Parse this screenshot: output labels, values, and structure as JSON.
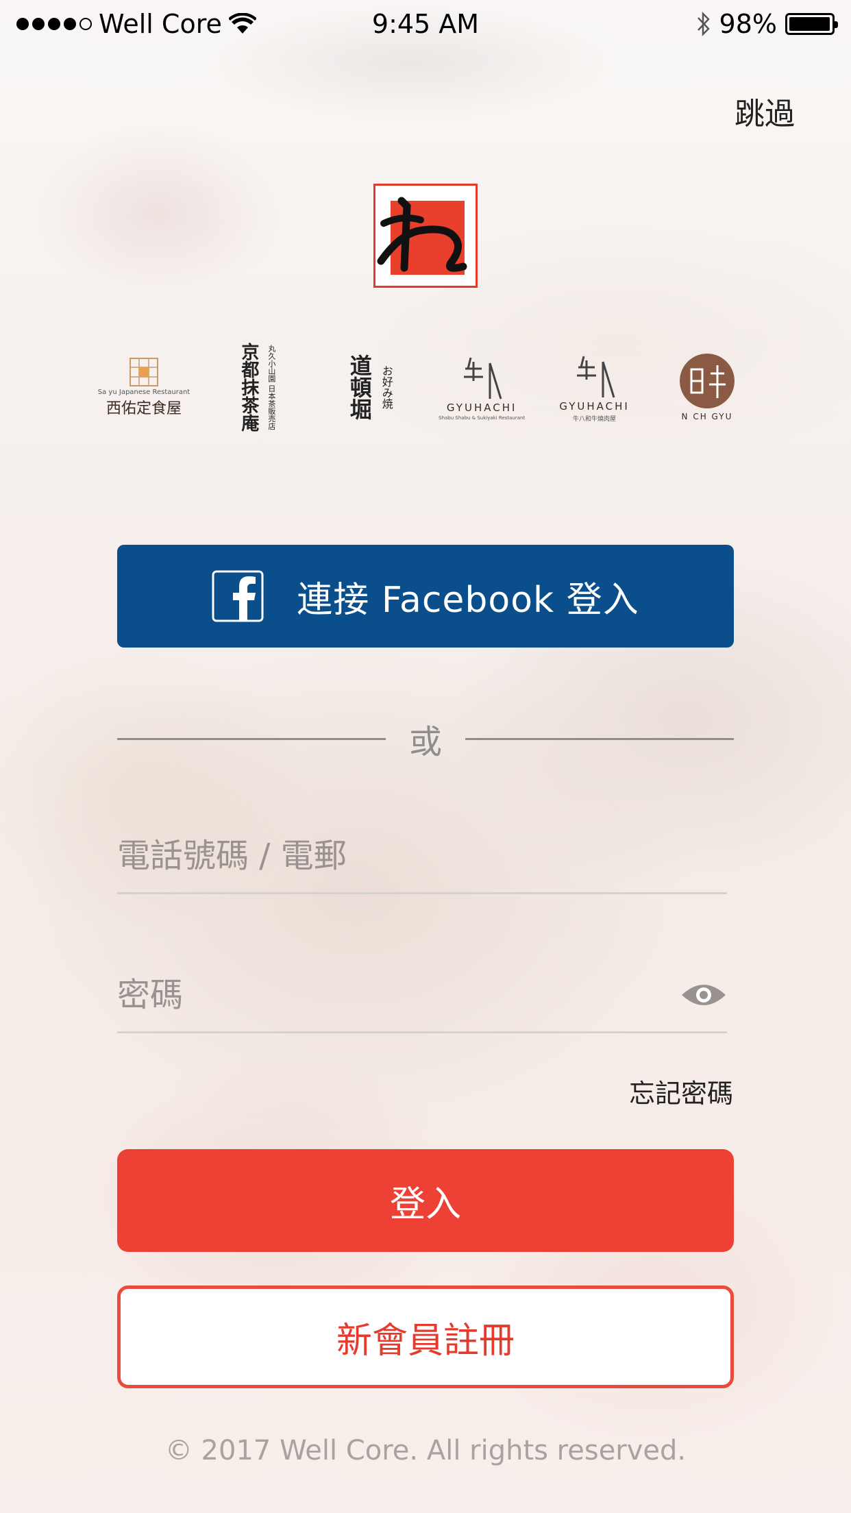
{
  "status_bar": {
    "carrier": "Well Core",
    "time": "9:45 AM",
    "battery": "98%",
    "battery_level": 0.98,
    "signal_bars_filled": 4,
    "signal_bars_total": 5,
    "icons": [
      "wifi-icon",
      "bluetooth-icon",
      "battery-icon"
    ]
  },
  "header": {
    "skip_label": "跳過"
  },
  "brands": [
    {
      "name": "西佑定食屋",
      "sub": "Sa yu Japanese Restaurant"
    },
    {
      "name": "京都抹茶庵",
      "sub": "丸久小山園 日本茶販売店"
    },
    {
      "name": "道頓堀",
      "sub": "お好み焼"
    },
    {
      "name": "GYUHACHI",
      "sub": "Shabu Shabu & Sukiyaki Restaurant"
    },
    {
      "name": "GYUHACHI",
      "sub": "牛八和牛燒肉屋"
    },
    {
      "name": "N CH GYU",
      "sub": ""
    }
  ],
  "facebook": {
    "label": "連接 Facebook 登入",
    "color": "#0a4e8c"
  },
  "divider": {
    "label": "或"
  },
  "form": {
    "phone_placeholder": "電話號碼 / 電郵",
    "password_placeholder": "密碼",
    "forgot_label": "忘記密碼"
  },
  "actions": {
    "login_label": "登入",
    "login_color": "#ee4135",
    "register_label": "新會員註冊"
  },
  "footer": {
    "copyright": "© 2017 Well Core. All rights reserved."
  }
}
